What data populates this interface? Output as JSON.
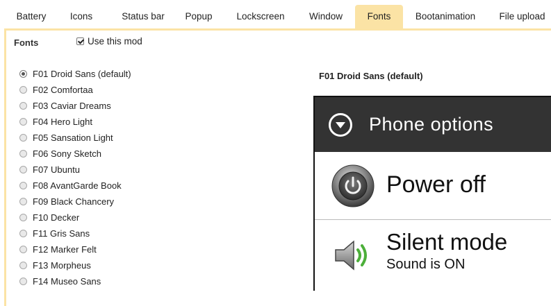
{
  "tabs": [
    {
      "label": "Battery"
    },
    {
      "label": "Icons"
    },
    {
      "label": "Status bar"
    },
    {
      "label": "Popup"
    },
    {
      "label": "Lockscreen"
    },
    {
      "label": "Window"
    },
    {
      "label": "Fonts",
      "active": true
    },
    {
      "label": "Bootanimation"
    },
    {
      "label": "File upload"
    }
  ],
  "panel": {
    "section_label": "Fonts",
    "use_mod_label": "Use this mod",
    "use_mod_checked": true
  },
  "fonts": [
    {
      "label": "F01 Droid Sans (default)",
      "checked": true
    },
    {
      "label": "F02 Comfortaa"
    },
    {
      "label": "F03 Caviar Dreams"
    },
    {
      "label": "F04 Hero Light"
    },
    {
      "label": "F05 Sansation Light"
    },
    {
      "label": "F06 Sony Sketch"
    },
    {
      "label": "F07 Ubuntu"
    },
    {
      "label": "F08 AvantGarde Book"
    },
    {
      "label": "F09 Black Chancery"
    },
    {
      "label": "F10 Decker"
    },
    {
      "label": "F11 Gris Sans"
    },
    {
      "label": "F12 Marker Felt"
    },
    {
      "label": "F13 Morpheus"
    },
    {
      "label": "F14 Museo Sans"
    }
  ],
  "preview": {
    "title": "F01 Droid Sans (default)",
    "header_icon": "chevron-down-circle-icon",
    "header_text": "Phone options",
    "row1_icon": "power-icon",
    "row1_text": "Power off",
    "row2_icon": "speaker-icon",
    "row2_title": "Silent mode",
    "row2_subtitle": "Sound is ON"
  },
  "colors": {
    "active_tab": "#fbe3a5",
    "preview_header": "#333333",
    "speaker_waves": "#4caf3a"
  }
}
